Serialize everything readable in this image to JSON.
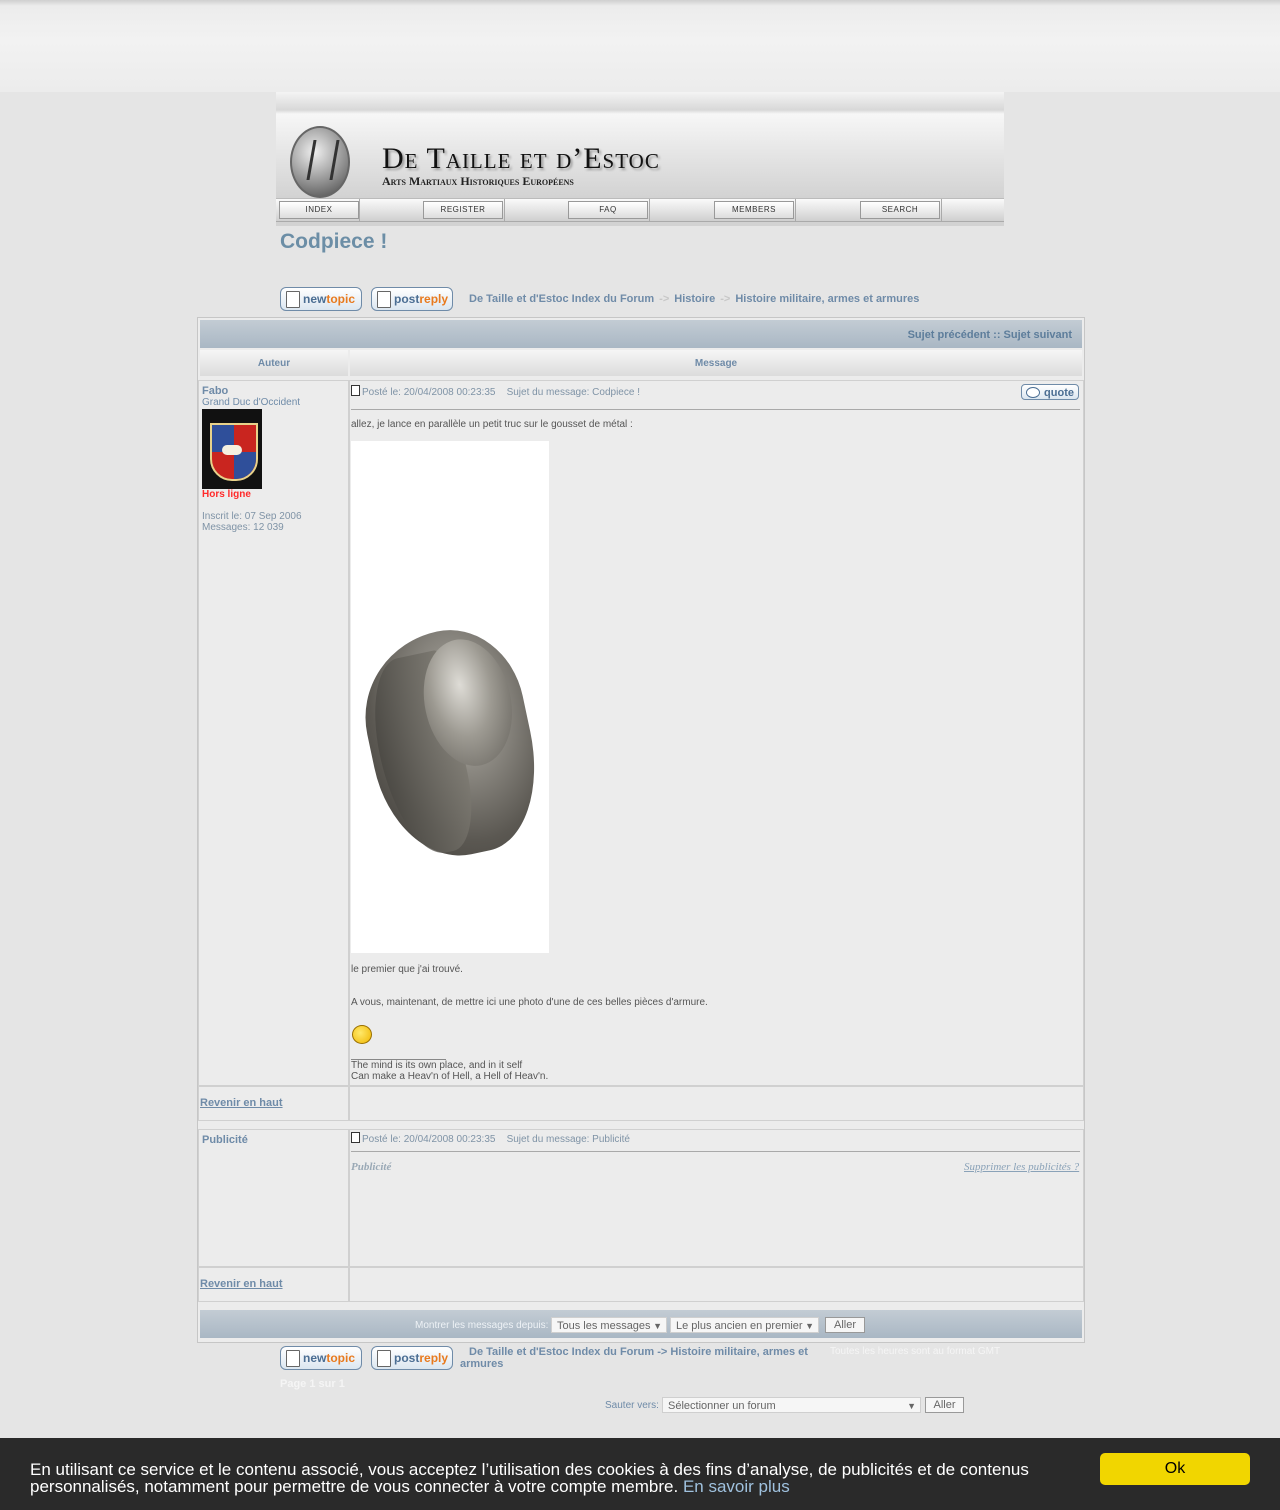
{
  "header": {
    "site_title": "De Taille et d’Estoc",
    "site_subtitle": "Arts Martiaux Historiques Européens",
    "nav": [
      "Index",
      "Register",
      "FAQ",
      "Members",
      "Search"
    ]
  },
  "topic": {
    "title": "Codpiece !"
  },
  "buttons": {
    "new_topic_pre": "new",
    "new_topic_post": "topic",
    "post_reply_pre": "post",
    "post_reply_post": "reply",
    "quote": "quote",
    "go": "Aller"
  },
  "breadcrumb_top": {
    "forum_index": "De Taille et d'Estoc Index du Forum",
    "sep": "->",
    "category": "Histoire",
    "forum": "Histoire militaire, armes et armures"
  },
  "breadcrumb_bottom": {
    "forum_index": "De Taille et d'Estoc Index du Forum",
    "sep": "->",
    "forum_line1": "Histoire militaire, armes et",
    "forum_line2": "armures"
  },
  "table": {
    "prev_next": "Sujet précédent :: Sujet suivant",
    "col_author": "Auteur",
    "col_message": "Message"
  },
  "post1": {
    "author": "Fabo",
    "rank": "Grand Duc d'Occident",
    "status": "Hors ligne",
    "joined": "Inscrit le: 07 Sep 2006",
    "messages": "Messages: 12 039",
    "posted": "Posté le: 20/04/2008 00:23:35",
    "subject": "Sujet du message: Codpiece !",
    "line1": "allez, je lance en parallèle un petit truc sur le gousset de métal :",
    "line2": "le premier que j'ai trouvé.",
    "line3": "A vous, maintenant, de mettre ici une photo d'une de ces belles pièces d'armure.",
    "sig1": "The mind is its own place, and in it self",
    "sig2": "Can make a Heav'n of Hell, a Hell of Heav'n."
  },
  "post2": {
    "author": "Publicité",
    "posted": "Posté le: 20/04/2008 00:23:35",
    "subject": "Sujet du message: Publicité",
    "label": "Publicité",
    "remove": "Supprimer les publicités ?"
  },
  "back_to_top": "Revenir en haut",
  "footer": {
    "show_since_label": "Montrer les messages depuis:",
    "show_since_value": "Tous les messages",
    "order_value": "Le plus ancien en premier",
    "timezone": "Toutes les heures sont au format GMT",
    "page": "Page 1 sur 1",
    "jump_label": "Sauter vers:",
    "jump_value": "Sélectionner un forum"
  },
  "cookie": {
    "message": "En utilisant ce service et le contenu associé, vous acceptez l’utilisation des cookies à des fins d’analyse, de publicités et de contenus personnalisés, notamment pour permettre de vous connecter à votre compte membre.",
    "learn_more": "En savoir plus",
    "ok": "Ok"
  }
}
